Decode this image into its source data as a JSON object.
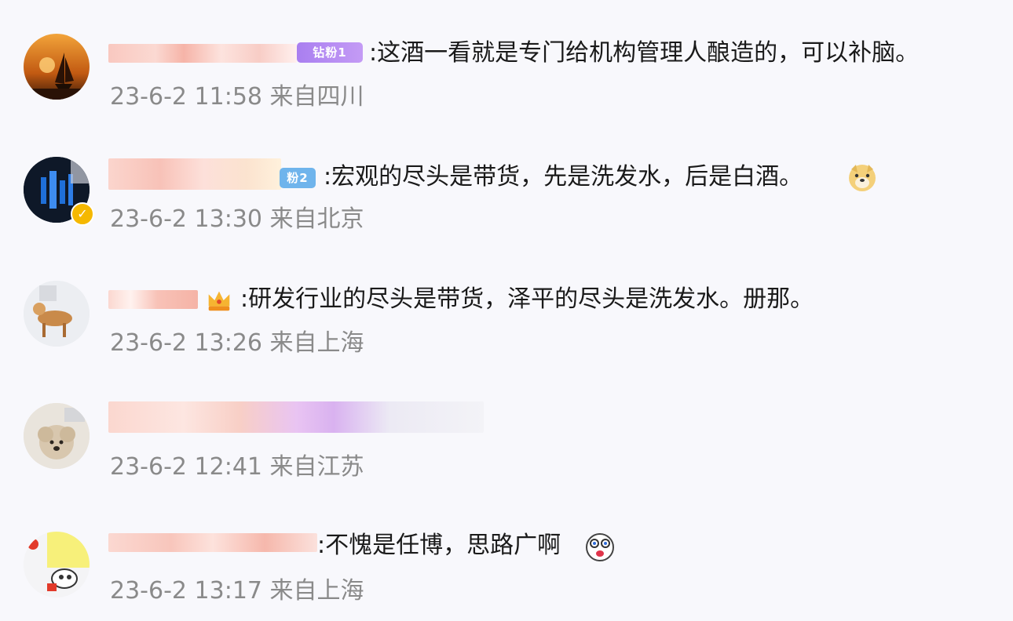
{
  "comments": [
    {
      "badge": "钻粉1",
      "text": ":这酒一看就是专门给机构管理人酿造的，可以补脑。",
      "time": "23-6-2 11:58",
      "location": "来自四川"
    },
    {
      "badge": "粉2",
      "text": ":宏观的尽头是带货，先是洗发水，后是白酒。",
      "time": "23-6-2 13:30",
      "location": "来自北京"
    },
    {
      "text": ":研发行业的尽头是带货，泽平的尽头是洗发水。册那。",
      "time": "23-6-2 13:26",
      "location": "来自上海"
    },
    {
      "time": "23-6-2 12:41",
      "location": "来自江苏"
    },
    {
      "text": ":不愧是任博，思路广啊",
      "time": "23-6-2 13:17",
      "location": "来自上海"
    }
  ]
}
